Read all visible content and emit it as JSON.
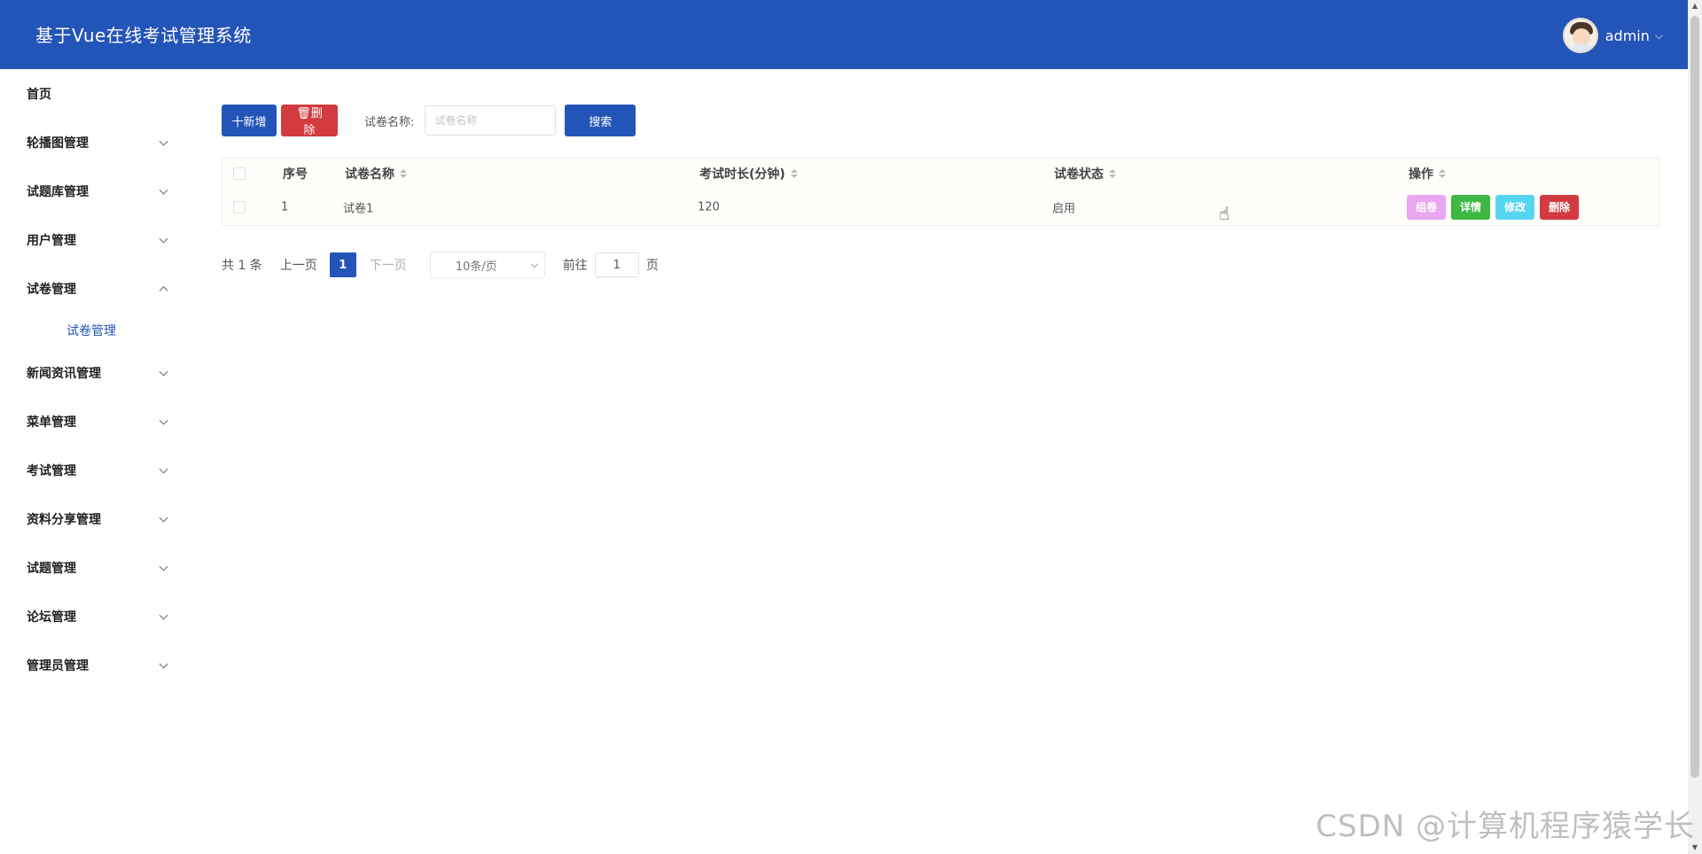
{
  "header": {
    "app_title": "基于Vue在线考试管理系统",
    "user_name": "admin",
    "user_caret": "⌵"
  },
  "sidebar": {
    "items": [
      {
        "label": "首页",
        "has_children": false
      },
      {
        "label": "轮播图管理",
        "has_children": true
      },
      {
        "label": "试题库管理",
        "has_children": true
      },
      {
        "label": "用户管理",
        "has_children": true
      },
      {
        "label": "试卷管理",
        "has_children": true,
        "expanded": true,
        "children": [
          {
            "label": "试卷管理"
          }
        ]
      },
      {
        "label": "新闻资讯管理",
        "has_children": true
      },
      {
        "label": "菜单管理",
        "has_children": true
      },
      {
        "label": "考试管理",
        "has_children": true
      },
      {
        "label": "资料分享管理",
        "has_children": true
      },
      {
        "label": "试题管理",
        "has_children": true
      },
      {
        "label": "论坛管理",
        "has_children": true
      },
      {
        "label": "管理员管理",
        "has_children": true
      }
    ]
  },
  "toolbar": {
    "add_label": "十新增",
    "delete_label": "🗑删除",
    "search_label": "试卷名称:",
    "search_placeholder": "试卷名称",
    "search_button": "搜索"
  },
  "table": {
    "headers": {
      "index": "序号",
      "name": "试卷名称",
      "duration": "考试时长(分钟)",
      "status": "试卷状态",
      "actions": "操作"
    },
    "rows": [
      {
        "index": "1",
        "name": "试卷1",
        "duration": "120",
        "status": "启用"
      }
    ],
    "row_actions": {
      "compose": "组卷",
      "detail": "详情",
      "edit": "修改",
      "remove": "删除"
    }
  },
  "pagination": {
    "total": "共 1 条",
    "prev": "上一页",
    "current": "1",
    "next": "下一页",
    "page_size": "10条/页",
    "goto_label": "前往",
    "goto_value": "1",
    "page_suffix": "页"
  },
  "watermark": "CSDN @计算机程序猿学长",
  "colors": {
    "primary": "#2354b8",
    "danger": "#d23b40",
    "success": "#3cb843",
    "info": "#56d5ef",
    "compose": "#e8a7f0"
  }
}
